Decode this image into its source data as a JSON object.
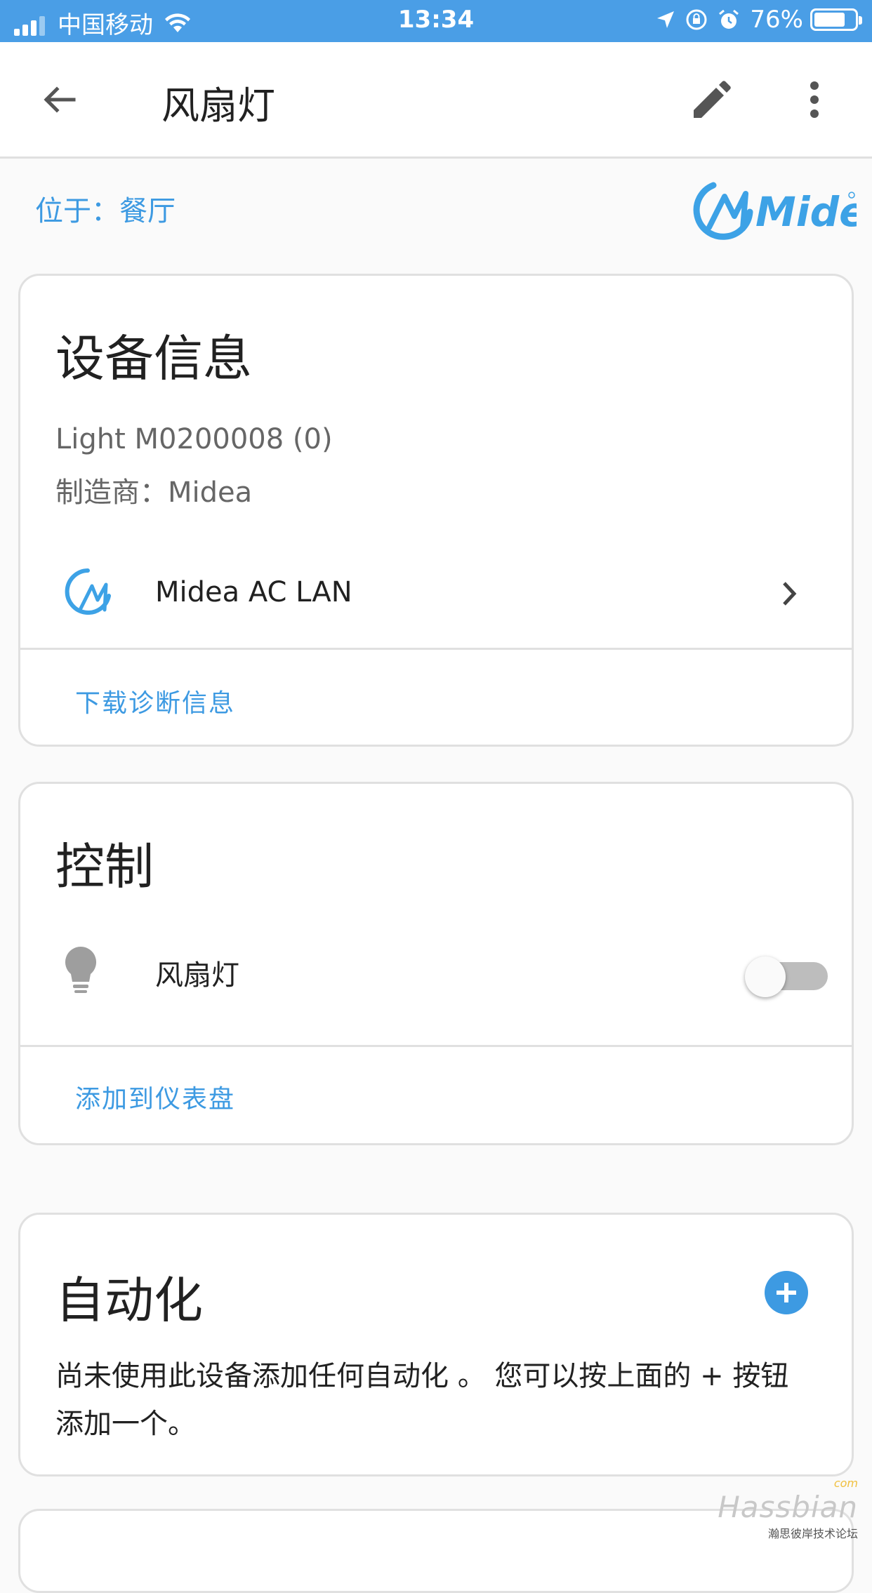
{
  "status_bar": {
    "carrier": "中国移动",
    "time": "13:34",
    "battery": "76%",
    "battery_level": 0.76
  },
  "toolbar": {
    "title": "风扇灯"
  },
  "location": {
    "text": "位于：餐厅"
  },
  "brand": {
    "name": "Midea",
    "color": "#3da2e6"
  },
  "device_info": {
    "heading": "设备信息",
    "model": "Light M0200008 (0)",
    "manufacturer": "制造商：Midea",
    "integration": "Midea AC LAN",
    "action": "下载诊断信息"
  },
  "controls": {
    "heading": "控制",
    "entity_label": "风扇灯",
    "entity_state": "off",
    "action": "添加到仪表盘"
  },
  "automation": {
    "heading": "自动化",
    "empty_text": "尚未使用此设备添加任何自动化 。 您可以按上面的 + 按钮添加一个。"
  },
  "watermark": {
    "brand": "Hassbian",
    "suffix": "com",
    "subtitle": "瀚思彼岸技术论坛"
  },
  "colors": {
    "status_bar": "#4a9ee6",
    "accent": "#3d9ae2",
    "divider": "#e0e0e0"
  }
}
